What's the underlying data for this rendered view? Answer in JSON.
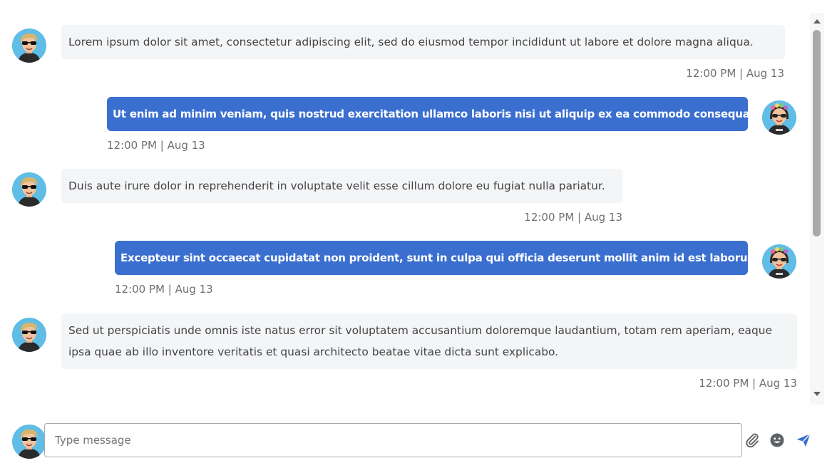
{
  "messages": [
    {
      "text": "Lorem ipsum dolor sit amet, consectetur adipiscing elit, sed do eiusmod tempor incididunt ut labore et dolore magna aliqua.",
      "time": "12:00 PM | Aug 13",
      "direction": "incoming"
    },
    {
      "text": "Ut enim ad minim veniam, quis nostrud exercitation ullamco laboris nisi ut aliquip ex ea commodo consequat.",
      "time": "12:00 PM | Aug 13",
      "direction": "outgoing"
    },
    {
      "text": "Duis aute irure dolor in reprehenderit in voluptate velit esse cillum dolore eu fugiat nulla pariatur.",
      "time": "12:00 PM | Aug 13",
      "direction": "incoming"
    },
    {
      "text": "Excepteur sint occaecat cupidatat non proident, sunt in culpa qui officia deserunt mollit anim id est laborum.",
      "time": "12:00 PM | Aug 13",
      "direction": "outgoing"
    },
    {
      "text": "Sed ut perspiciatis unde omnis iste natus error sit voluptatem accusantium doloremque laudantium, totam rem aperiam, eaque ipsa quae ab illo inventore veritatis et quasi architecto beatae vitae dicta sunt explicabo.",
      "time": "12:00 PM | Aug 13",
      "direction": "incoming"
    }
  ],
  "composer": {
    "placeholder": "Type message",
    "value": ""
  },
  "icons": {
    "attach": "paperclip-icon",
    "emoji": "smiley-icon",
    "send": "paper-plane-icon"
  },
  "colors": {
    "outgoing_bubble": "#3a6fd0",
    "incoming_bubble": "#f4f5f7",
    "send_icon": "#3a6fd0",
    "avatar_background": "#5fbde6"
  }
}
